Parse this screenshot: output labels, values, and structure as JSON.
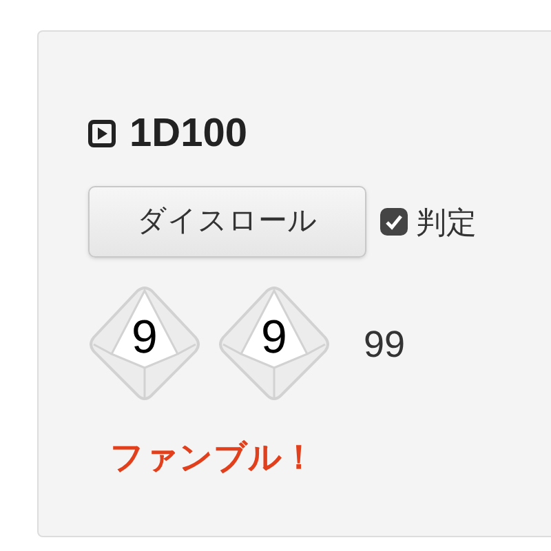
{
  "title": "1D100",
  "roll_button": "ダイスロール",
  "judge": {
    "label": "判定",
    "checked": true
  },
  "dice": [
    {
      "value": "9"
    },
    {
      "value": "9"
    }
  ],
  "total": "99",
  "result": {
    "text": "ファンブル！",
    "kind": "fumble"
  }
}
